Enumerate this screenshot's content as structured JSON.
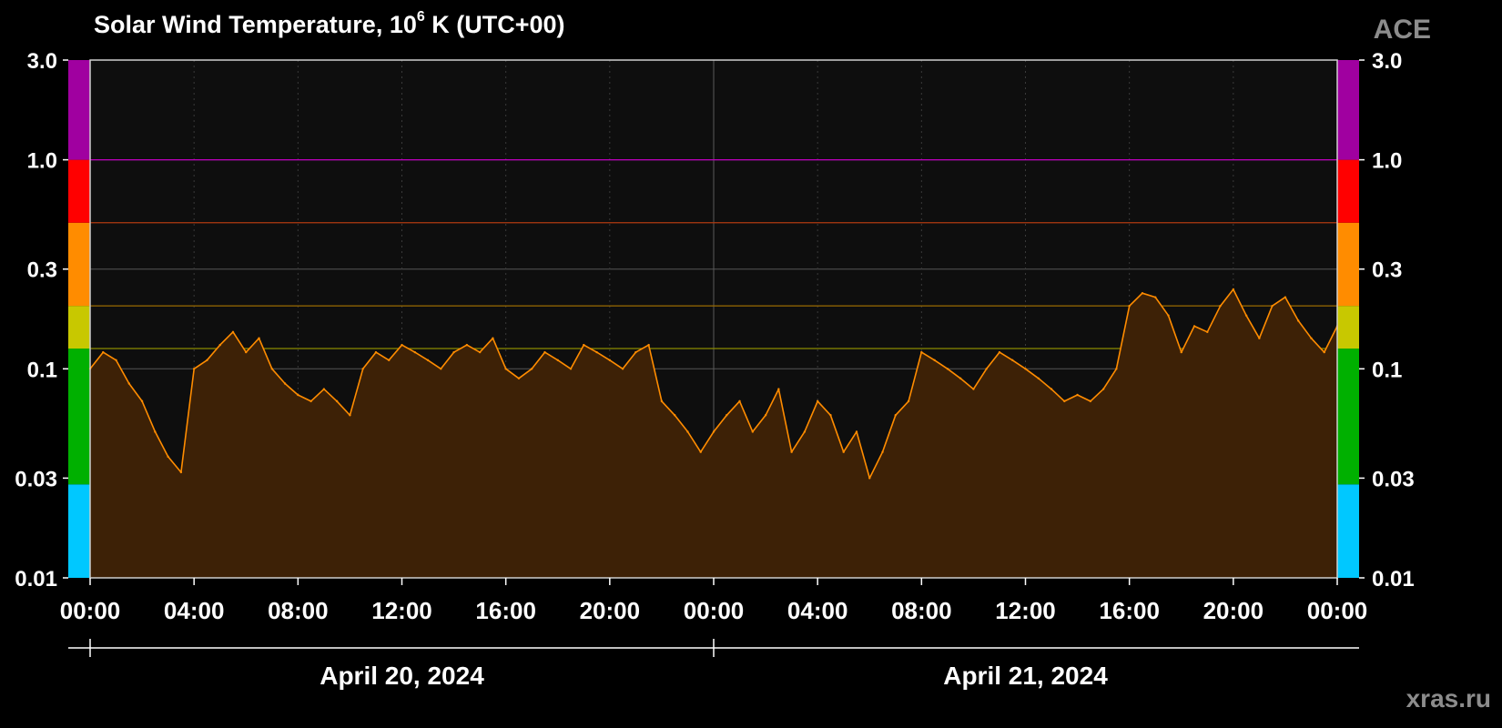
{
  "header": {
    "title_prefix": "Solar Wind Temperature, 10",
    "title_sup": "6",
    "title_suffix": " K (UTC+00)",
    "source": "ACE",
    "credit": "xras.ru"
  },
  "colors": {
    "background": "#000000",
    "plot_bg": "#0e0e0e",
    "series": "#ff8c00",
    "fill": "#3d2106",
    "grid": "#555555"
  },
  "chart_data": {
    "type": "area",
    "title": "Solar Wind Temperature, 10^6 K (UTC+00)",
    "y_scale": "log",
    "ylim": [
      0.01,
      3.0
    ],
    "y_ticks": [
      "3.0",
      "1.0",
      "0.3",
      "0.1",
      "0.03",
      "0.01"
    ],
    "y_tick_values": [
      3.0,
      1.0,
      0.3,
      0.1,
      0.03,
      0.01
    ],
    "x_ticks": [
      "00:00",
      "04:00",
      "08:00",
      "12:00",
      "16:00",
      "20:00",
      "00:00",
      "04:00",
      "08:00",
      "12:00",
      "16:00",
      "20:00",
      "00:00"
    ],
    "x_tick_hours": [
      0,
      4,
      8,
      12,
      16,
      20,
      24,
      28,
      32,
      36,
      40,
      44,
      48
    ],
    "date_labels": [
      "April 20, 2024",
      "April 21, 2024"
    ],
    "xlim_hours": [
      0,
      48
    ],
    "grid": true,
    "threshold_levels": [
      {
        "value": 0.5,
        "color": "#b03a10"
      },
      {
        "value": 1.0,
        "color": "#c000c0"
      },
      {
        "value": 0.2,
        "color": "#9a6a00"
      },
      {
        "value": 0.125,
        "color": "#8a8a00"
      }
    ],
    "scale_bands": [
      {
        "from": 0.01,
        "to": 0.028,
        "color": "#00c8ff"
      },
      {
        "from": 0.028,
        "to": 0.125,
        "color": "#00b000"
      },
      {
        "from": 0.125,
        "to": 0.2,
        "color": "#c8c800"
      },
      {
        "from": 0.2,
        "to": 0.5,
        "color": "#ff8c00"
      },
      {
        "from": 0.5,
        "to": 1.0,
        "color": "#ff0000"
      },
      {
        "from": 1.0,
        "to": 3.0,
        "color": "#a000a0"
      }
    ],
    "series": [
      {
        "x_hours": [
          0,
          0.5,
          1,
          1.5,
          2,
          2.5,
          3,
          3.5,
          4,
          4.5,
          5,
          5.5,
          6,
          6.5,
          7,
          7.5,
          8,
          8.5,
          9,
          9.5,
          10,
          10.5,
          11,
          11.5,
          12,
          12.5,
          13,
          13.5,
          14,
          14.5,
          15,
          15.5,
          16,
          16.5,
          17,
          17.5,
          18,
          18.5,
          19,
          19.5,
          20,
          20.5,
          21,
          21.5,
          22,
          22.5,
          23,
          23.5,
          24,
          24.5,
          25,
          25.5,
          26,
          26.5,
          27,
          27.5,
          28,
          28.5,
          29,
          29.5,
          30,
          30.5,
          31,
          31.5,
          32,
          32.5,
          33,
          33.5,
          34,
          34.5,
          35,
          35.5,
          36,
          36.5,
          37,
          37.5,
          38,
          38.5,
          39,
          39.5,
          40,
          40.5,
          41,
          41.5,
          42,
          42.5,
          43,
          43.5,
          44,
          44.5,
          45,
          45.5,
          46,
          46.5,
          47,
          47.5,
          48
        ],
        "values": [
          0.1,
          0.12,
          0.11,
          0.085,
          0.07,
          0.05,
          0.038,
          0.032,
          0.1,
          0.11,
          0.13,
          0.15,
          0.12,
          0.14,
          0.1,
          0.085,
          0.075,
          0.07,
          0.08,
          0.07,
          0.06,
          0.1,
          0.12,
          0.11,
          0.13,
          0.12,
          0.11,
          0.1,
          0.12,
          0.13,
          0.12,
          0.14,
          0.1,
          0.09,
          0.1,
          0.12,
          0.11,
          0.1,
          0.13,
          0.12,
          0.11,
          0.1,
          0.12,
          0.13,
          0.07,
          0.06,
          0.05,
          0.04,
          0.05,
          0.06,
          0.07,
          0.05,
          0.06,
          0.08,
          0.04,
          0.05,
          0.07,
          0.06,
          0.04,
          0.05,
          0.03,
          0.04,
          0.06,
          0.07,
          0.12,
          0.11,
          0.1,
          0.09,
          0.08,
          0.1,
          0.12,
          0.11,
          0.1,
          0.09,
          0.08,
          0.07,
          0.075,
          0.07,
          0.08,
          0.1,
          0.2,
          0.23,
          0.22,
          0.18,
          0.12,
          0.16,
          0.15,
          0.2,
          0.24,
          0.18,
          0.14,
          0.2,
          0.22,
          0.17,
          0.14,
          0.12,
          0.16
        ]
      }
    ]
  }
}
